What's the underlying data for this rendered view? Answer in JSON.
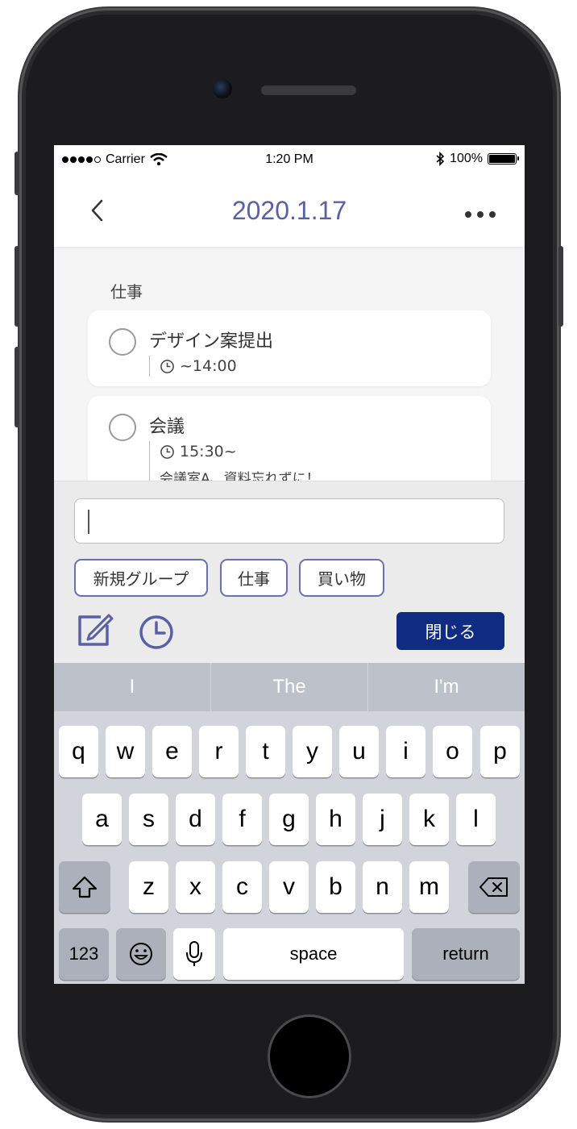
{
  "status_bar": {
    "carrier": "Carrier",
    "time": "1:20 PM",
    "battery": "100%"
  },
  "nav": {
    "title": "2020.1.17"
  },
  "content": {
    "group_label": "仕事",
    "tasks": [
      {
        "title": "デザイン案提出",
        "time": "~14:00",
        "memo": ""
      },
      {
        "title": "会議",
        "time": "15:30~",
        "memo": "会議室A、資料忘れずに！"
      }
    ]
  },
  "input_panel": {
    "text_value": "",
    "chips": [
      "新規グループ",
      "仕事",
      "買い物"
    ],
    "close_label": "閉じる"
  },
  "keyboard": {
    "suggestions": [
      "I",
      "The",
      "I'm"
    ],
    "row1": [
      "q",
      "w",
      "e",
      "r",
      "t",
      "y",
      "u",
      "i",
      "o",
      "p"
    ],
    "row2": [
      "a",
      "s",
      "d",
      "f",
      "g",
      "h",
      "j",
      "k",
      "l"
    ],
    "row3": [
      "z",
      "x",
      "c",
      "v",
      "b",
      "n",
      "m"
    ],
    "numbers_label": "123",
    "space_label": "space",
    "return_label": "return"
  },
  "colors": {
    "accent": "#5a5fa6",
    "primary_button": "#0f2b82",
    "chip_border": "#6d70b0"
  }
}
